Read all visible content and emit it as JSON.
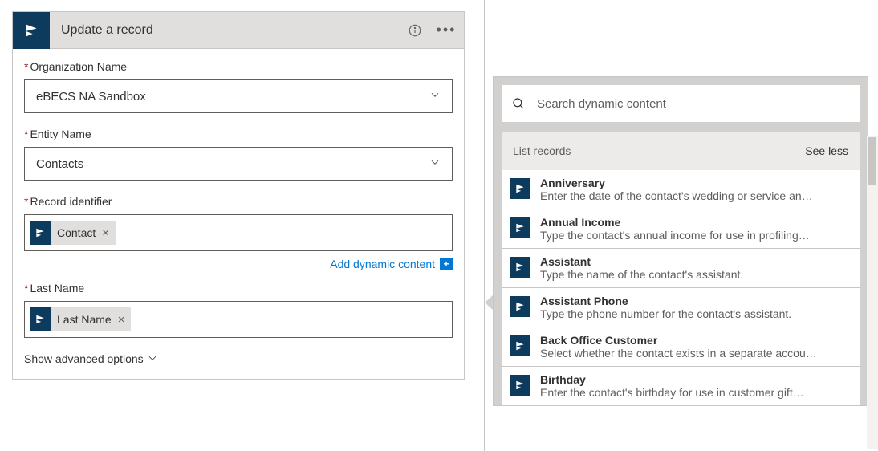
{
  "action": {
    "title": "Update a record",
    "fields": {
      "org_label": "Organization Name",
      "org_value": "eBECS NA Sandbox",
      "entity_label": "Entity Name",
      "entity_value": "Contacts",
      "record_label": "Record identifier",
      "record_token": "Contact",
      "lastname_label": "Last Name",
      "lastname_token": "Last Name"
    },
    "links": {
      "add_dynamic": "Add dynamic content",
      "show_advanced": "Show advanced options"
    }
  },
  "dynPanel": {
    "search_placeholder": "Search dynamic content",
    "section_title": "List records",
    "see_less": "See less",
    "items": [
      {
        "title": "Anniversary",
        "desc": "Enter the date of the contact's wedding or service an…"
      },
      {
        "title": "Annual Income",
        "desc": "Type the contact's annual income for use in profiling…"
      },
      {
        "title": "Assistant",
        "desc": "Type the name of the contact's assistant."
      },
      {
        "title": "Assistant Phone",
        "desc": "Type the phone number for the contact's assistant."
      },
      {
        "title": "Back Office Customer",
        "desc": "Select whether the contact exists in a separate accou…"
      },
      {
        "title": "Birthday",
        "desc": "Enter the contact's birthday for use in customer gift…"
      }
    ]
  }
}
